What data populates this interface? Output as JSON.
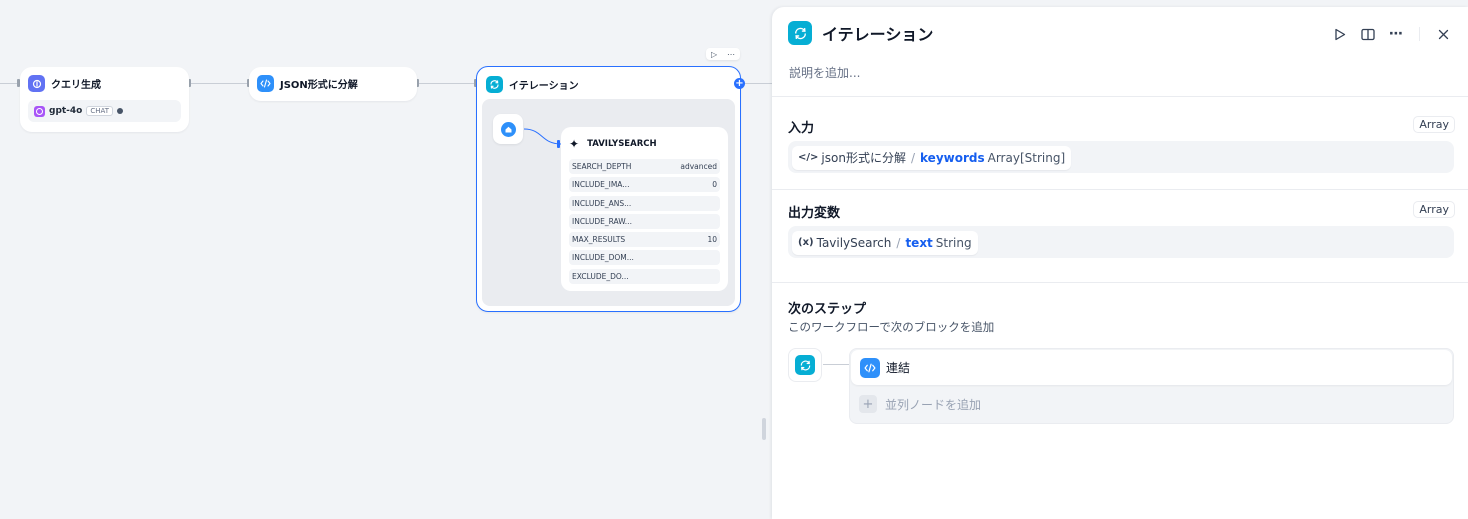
{
  "canvas": {
    "nodes": {
      "query": {
        "title": "クエリ生成",
        "model": "gpt-4o",
        "mode": "CHAT"
      },
      "json_split": {
        "title": "JSON形式に分解"
      },
      "iteration": {
        "title": "イテレーション"
      },
      "tavily": {
        "title": "TAVILYSEARCH",
        "params": [
          {
            "name": "SEARCH_DEPTH",
            "value": "advanced"
          },
          {
            "name": "INCLUDE_IMA...",
            "value": "0"
          },
          {
            "name": "INCLUDE_ANS...",
            "value": ""
          },
          {
            "name": "INCLUDE_RAW...",
            "value": ""
          },
          {
            "name": "MAX_RESULTS",
            "value": "10"
          },
          {
            "name": "INCLUDE_DOM...",
            "value": ""
          },
          {
            "name": "EXCLUDE_DO...",
            "value": ""
          }
        ]
      }
    }
  },
  "panel": {
    "title": "イテレーション",
    "description_placeholder": "説明を追加...",
    "input": {
      "label": "入力",
      "type_badge": "Array",
      "source": "json形式に分解",
      "variable": "keywords",
      "var_type": "Array[String]"
    },
    "output": {
      "label": "出力変数",
      "type_badge": "Array",
      "source": "TavilySearch",
      "variable": "text",
      "var_type": "String"
    },
    "next_step": {
      "label": "次のステップ",
      "subtitle": "このワークフローで次のブロックを追加",
      "item": "連結",
      "add_parallel": "並列ノードを追加"
    }
  },
  "colors": {
    "accent": "#2970ff",
    "iteration_icon": "#06aed4",
    "code_icon": "#2e90fa",
    "llm_icon": "#6172f3",
    "variable_name": "#155eef"
  }
}
